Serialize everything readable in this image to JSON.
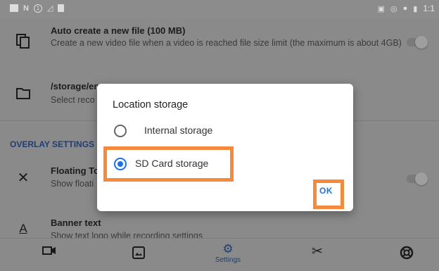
{
  "status_bar": {
    "left_icons": [
      "image-icon",
      "n-icon",
      "circle-1-icon",
      "signal-icon",
      "sd-icon"
    ],
    "right_icons": [
      "cast-icon",
      "wifi-icon",
      "location-icon",
      "battery-icon"
    ],
    "time": "1:1"
  },
  "settings": {
    "auto_create": {
      "title": "Auto create a new file (100 MB)",
      "subtitle": "Create a new video file when a video is reached file size limit (the maximum is about 4GB)",
      "icon": "copy-icon"
    },
    "storage_path": {
      "title": "/storage/em",
      "subtitle": "Select reco",
      "icon": "folder-icon"
    },
    "overlay_header": "OVERLAY SETTINGS",
    "floating": {
      "title": "Floating To",
      "subtitle": "Show floati",
      "icon": "close-icon"
    },
    "banner": {
      "title": "Banner text",
      "subtitle": "Show text logo while recording settings",
      "icon": "text-format-icon"
    }
  },
  "bottom_nav": {
    "items": [
      {
        "icon": "video-camera-icon",
        "label": ""
      },
      {
        "icon": "screenshot-icon",
        "label": ""
      },
      {
        "icon": "settings-gear-icon",
        "label": "Settings"
      },
      {
        "icon": "scissors-icon",
        "label": ""
      },
      {
        "icon": "help-lifebuoy-icon",
        "label": ""
      }
    ]
  },
  "dialog": {
    "title": "Location storage",
    "options": [
      {
        "label": "Internal storage",
        "selected": false
      },
      {
        "label": "SD Card storage",
        "selected": true
      }
    ],
    "ok_label": "OK"
  },
  "colors": {
    "accent": "#1a73e8",
    "highlight": "#f58a3c",
    "section_header": "#1f3e73",
    "dim_background": "#8a8a8a"
  }
}
